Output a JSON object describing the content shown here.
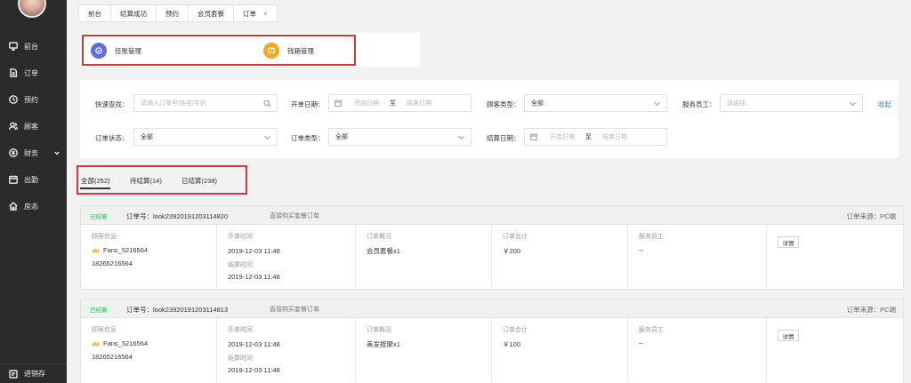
{
  "sidebar": {
    "items": [
      {
        "label": "前台",
        "icon": "monitor-icon"
      },
      {
        "label": "订单",
        "icon": "document-icon"
      },
      {
        "label": "预约",
        "icon": "clock-icon"
      },
      {
        "label": "顾客",
        "icon": "users-icon"
      },
      {
        "label": "财务",
        "icon": "finance-icon"
      },
      {
        "label": "出勤",
        "icon": "calendar-icon"
      },
      {
        "label": "房态",
        "icon": "home-icon"
      }
    ],
    "bottom": {
      "label": "进销存",
      "icon": "box-icon"
    }
  },
  "tabs": [
    {
      "label": "前台"
    },
    {
      "label": "结算成功"
    },
    {
      "label": "预约"
    },
    {
      "label": "会员套餐"
    },
    {
      "label": "订单",
      "close": "×"
    }
  ],
  "quick": {
    "hang": {
      "label": "挂账管理",
      "color": "#5b6ee1"
    },
    "cashbox": {
      "label": "钱箱管理",
      "color": "#f5a623"
    }
  },
  "filter": {
    "search_label": "快速查找：",
    "search_placeholder": "请输入订单号/姓名/手机",
    "open_date_label": "开单日期：",
    "start_date": "开始日期",
    "to": "至",
    "end_date": "结束日期",
    "customer_type_label": "顾客类型：",
    "customer_type_value": "全部",
    "staff_label": "服务员工：",
    "staff_placeholder": "请选择",
    "collapse": "收起",
    "status_label": "订单状态：",
    "status_value": "全部",
    "order_type_label": "订单类型：",
    "order_type_value": "全部",
    "settle_date_label": "结算日期："
  },
  "status_tabs": [
    {
      "label": "全部(252)"
    },
    {
      "label": "待结算(14)"
    },
    {
      "label": "已结算(238)"
    }
  ],
  "columns": {
    "customer": "顾客信息",
    "open_time": "开单时间",
    "settle_time": "结算时间",
    "overview": "订单概况",
    "total": "订单合计",
    "staff": "服务员工",
    "detail": "详情"
  },
  "orders": [
    {
      "status": "已结算",
      "order_no": "订单号：look23920191203114820",
      "type": "直接购买套餐订单",
      "source": "订单来源：PC端",
      "customer_name": "Fans_5216564",
      "customer_phone": "18265216564",
      "open_time": "2019-12-03 11:48",
      "settle_time": "2019-12-03 11:48",
      "overview": "会员套餐x1",
      "total": "￥200",
      "staff": "--"
    },
    {
      "status": "已结算",
      "order_no": "订单号：look23920191203114813",
      "type": "直接购买套餐订单",
      "source": "订单来源：PC端",
      "customer_name": "Fans_5216564",
      "customer_phone": "18265216564",
      "open_time": "2019-12-03 11:48",
      "settle_time": "2019-12-03 11:48",
      "overview": "美发按摩x1",
      "total": "￥100",
      "staff": "--"
    }
  ]
}
